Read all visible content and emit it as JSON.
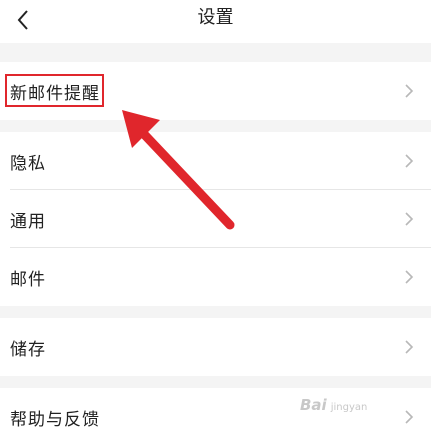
{
  "header": {
    "title": "设置"
  },
  "sections": [
    {
      "items": [
        {
          "label": "新邮件提醒"
        }
      ]
    },
    {
      "items": [
        {
          "label": "隐私"
        },
        {
          "label": "通用"
        },
        {
          "label": "邮件"
        }
      ]
    },
    {
      "items": [
        {
          "label": "储存"
        }
      ]
    },
    {
      "items": [
        {
          "label": "帮助与反馈"
        }
      ]
    }
  ],
  "annotation": {
    "color": "#e0262c"
  },
  "watermark": {
    "brand": "Bai",
    "site": "jingyan"
  },
  "icons": {
    "back": "chevron-left-icon",
    "row": "chevron-right-icon"
  }
}
